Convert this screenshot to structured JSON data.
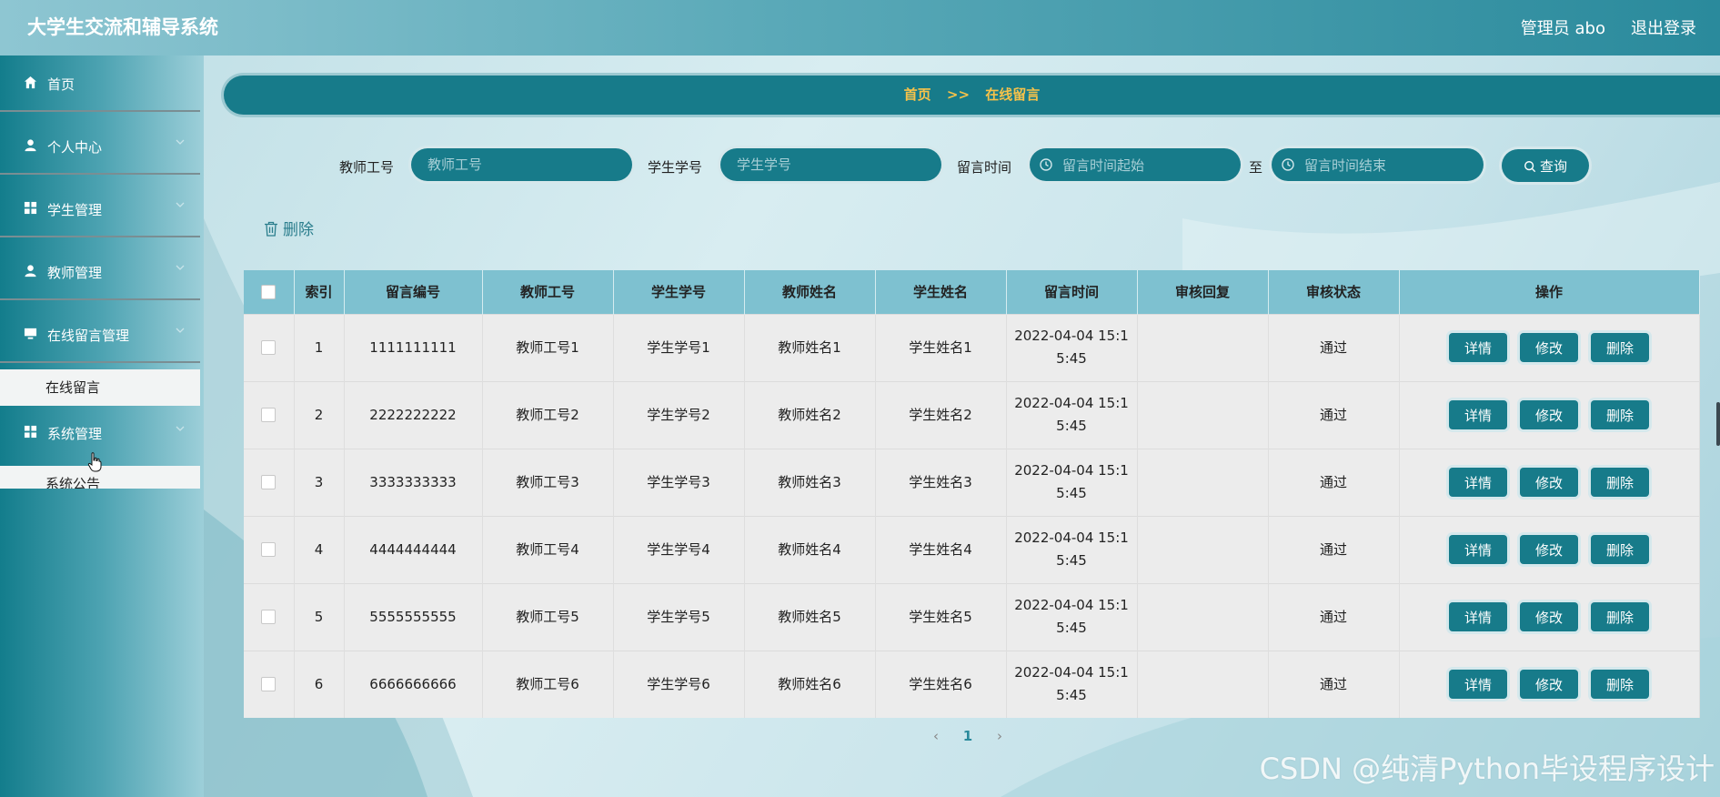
{
  "app": {
    "title": "大学生交流和辅导系统",
    "user_label": "管理员 abo",
    "logout_label": "退出登录"
  },
  "sidebar": {
    "items": [
      {
        "label": "首页",
        "icon": "home-icon"
      },
      {
        "label": "个人中心",
        "icon": "user-icon"
      },
      {
        "label": "学生管理",
        "icon": "grid-icon"
      },
      {
        "label": "教师管理",
        "icon": "user-icon"
      },
      {
        "label": "在线留言管理",
        "icon": "monitor-icon"
      },
      {
        "label": "系统管理",
        "icon": "grid-icon"
      }
    ],
    "sub_online_message": "在线留言",
    "sub_system": "系统公告"
  },
  "breadcrumb": {
    "home": "首页",
    "separator": ">>",
    "current": "在线留言"
  },
  "search": {
    "teacher_id_label": "教师工号",
    "teacher_id_placeholder": "教师工号",
    "student_id_label": "学生学号",
    "student_id_placeholder": "学生学号",
    "time_label": "留言时间",
    "time_start_placeholder": "留言时间起始",
    "time_to": "至",
    "time_end_placeholder": "留言时间结束",
    "query_label": "查询"
  },
  "bulk_delete_label": "删除",
  "table": {
    "headers": [
      "索引",
      "留言编号",
      "教师工号",
      "学生学号",
      "教师姓名",
      "学生姓名",
      "留言时间",
      "审核回复",
      "审核状态",
      "操作"
    ],
    "rows": [
      {
        "index": "1",
        "msg_id": "1111111111",
        "teacher_id": "教师工号1",
        "student_id": "学生学号1",
        "teacher_name": "教师姓名1",
        "student_name": "学生姓名1",
        "time_line1": "2022-04-04 15:1",
        "time_line2": "5:45",
        "reply": "",
        "status": "通过"
      },
      {
        "index": "2",
        "msg_id": "2222222222",
        "teacher_id": "教师工号2",
        "student_id": "学生学号2",
        "teacher_name": "教师姓名2",
        "student_name": "学生姓名2",
        "time_line1": "2022-04-04 15:1",
        "time_line2": "5:45",
        "reply": "",
        "status": "通过"
      },
      {
        "index": "3",
        "msg_id": "3333333333",
        "teacher_id": "教师工号3",
        "student_id": "学生学号3",
        "teacher_name": "教师姓名3",
        "student_name": "学生姓名3",
        "time_line1": "2022-04-04 15:1",
        "time_line2": "5:45",
        "reply": "",
        "status": "通过"
      },
      {
        "index": "4",
        "msg_id": "4444444444",
        "teacher_id": "教师工号4",
        "student_id": "学生学号4",
        "teacher_name": "教师姓名4",
        "student_name": "学生姓名4",
        "time_line1": "2022-04-04 15:1",
        "time_line2": "5:45",
        "reply": "",
        "status": "通过"
      },
      {
        "index": "5",
        "msg_id": "5555555555",
        "teacher_id": "教师工号5",
        "student_id": "学生学号5",
        "teacher_name": "教师姓名5",
        "student_name": "学生姓名5",
        "time_line1": "2022-04-04 15:1",
        "time_line2": "5:45",
        "reply": "",
        "status": "通过"
      },
      {
        "index": "6",
        "msg_id": "6666666666",
        "teacher_id": "教师工号6",
        "student_id": "学生学号6",
        "teacher_name": "教师姓名6",
        "student_name": "学生姓名6",
        "time_line1": "2022-04-04 15:1",
        "time_line2": "5:45",
        "reply": "",
        "status": "通过"
      }
    ],
    "actions": {
      "detail": "详情",
      "edit": "修改",
      "delete": "删除"
    }
  },
  "pagination": {
    "prev": "‹",
    "current": "1",
    "next": "›"
  },
  "watermark": "CSDN @纯清Python毕设程序设计",
  "colors": {
    "accent": "#177b8a",
    "header_bg": "#7ec1d0",
    "breadcrumb_text": "#f6c24a"
  }
}
